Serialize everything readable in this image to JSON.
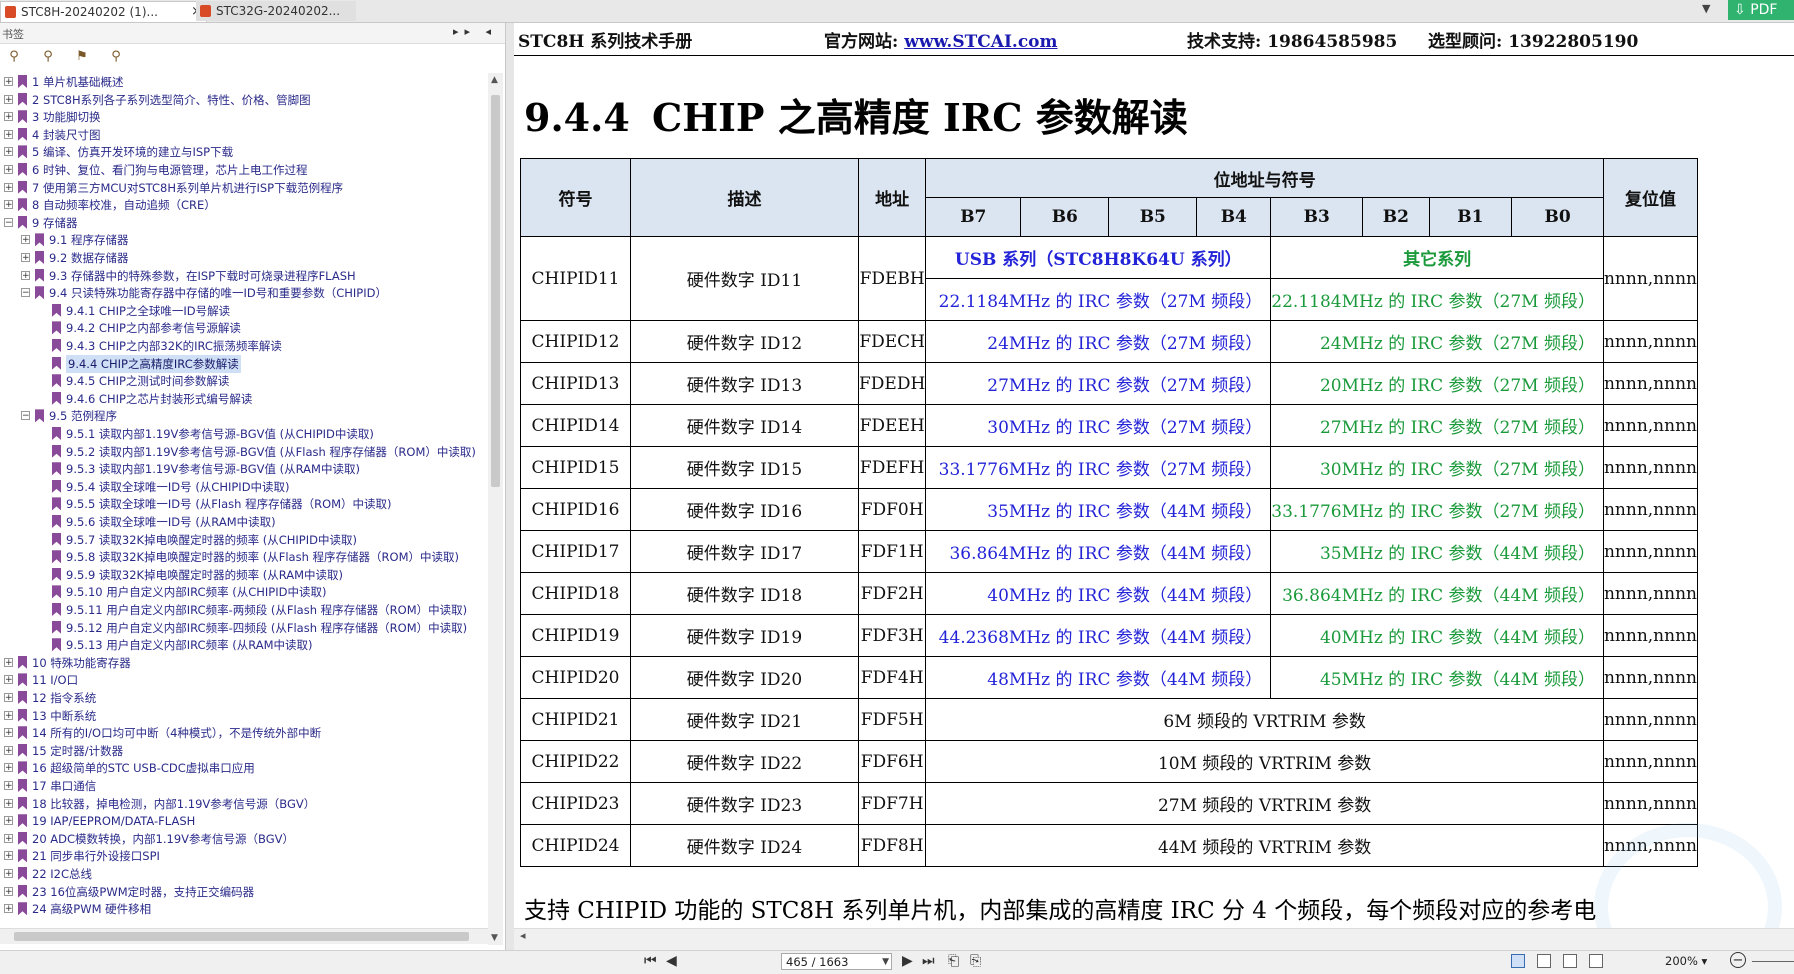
{
  "tabs": [
    {
      "label": "STC8H-20240202 (1)...",
      "close": "×",
      "active": true
    },
    {
      "label": "STC32G-20240202...",
      "active": false
    }
  ],
  "pdf_badge": "PDF",
  "bookmarks_panel": {
    "title": "书签",
    "header_controls": "▸▸ ◂",
    "items": [
      {
        "label": "1 单片机基础概述",
        "level": 0
      },
      {
        "label": "2  STC8H系列各子系列选型简介、特性、价格、管脚图",
        "level": 0
      },
      {
        "label": "3  功能脚切换",
        "level": 0
      },
      {
        "label": "4  封装尺寸图",
        "level": 0
      },
      {
        "label": "5  编译、仿真开发环境的建立与ISP下载",
        "level": 0
      },
      {
        "label": "6  时钟、复位、看门狗与电源管理，芯片上电工作过程",
        "level": 0
      },
      {
        "label": "7  使用第三方MCU对STC8H系列单片机进行ISP下载范例程序",
        "level": 0
      },
      {
        "label": "8  自动频率校准，自动追频（CRE）",
        "level": 0
      },
      {
        "label": "9  存储器",
        "level": 0,
        "expanded": true
      },
      {
        "label": "9.1 程序存储器",
        "level": 1
      },
      {
        "label": "9.2  数据存储器",
        "level": 1
      },
      {
        "label": "9.3  存储器中的特殊参数，在ISP下载时可烧录进程序FLASH",
        "level": 1
      },
      {
        "label": "9.4  只读特殊功能寄存器中存储的唯一ID号和重要参数（CHIPID）",
        "level": 1,
        "expanded": true
      },
      {
        "label": "9.4.1  CHIP之全球唯一ID号解读",
        "level": 2
      },
      {
        "label": "9.4.2 CHIP之内部参考信号源解读",
        "level": 2
      },
      {
        "label": "9.4.3 CHIP之内部32K的IRC振荡频率解读",
        "level": 2
      },
      {
        "label": "9.4.4  CHIP之高精度IRC参数解读",
        "level": 2,
        "selected": true
      },
      {
        "label": "9.4.5  CHIP之测试时间参数解读",
        "level": 2
      },
      {
        "label": "9.4.6 CHIP之芯片封装形式编号解读",
        "level": 2
      },
      {
        "label": "9.5  范例程序",
        "level": 1,
        "expanded": true
      },
      {
        "label": "9.5.1 读取内部1.19V参考信号源-BGV值 (从CHIPID中读取)",
        "level": 2
      },
      {
        "label": "9.5.2 读取内部1.19V参考信号源-BGV值 (从Flash 程序存储器（ROM）中读取)",
        "level": 2
      },
      {
        "label": "9.5.3 读取内部1.19V参考信号源-BGV值 (从RAM中读取)",
        "level": 2
      },
      {
        "label": "9.5.4 读取全球唯一ID号 (从CHIPID中读取)",
        "level": 2
      },
      {
        "label": "9.5.5 读取全球唯一ID号 (从Flash 程序存储器（ROM）中读取)",
        "level": 2
      },
      {
        "label": "9.5.6 读取全球唯一ID号 (从RAM中读取)",
        "level": 2
      },
      {
        "label": "9.5.7 读取32K掉电唤醒定时器的频率 (从CHIPID中读取)",
        "level": 2
      },
      {
        "label": "9.5.8 读取32K掉电唤醒定时器的频率 (从Flash 程序存储器（ROM）中读取)",
        "level": 2
      },
      {
        "label": "9.5.9 读取32K掉电唤醒定时器的频率 (从RAM中读取)",
        "level": 2
      },
      {
        "label": "9.5.10 用户自定义内部IRC频率 (从CHIPID中读取)",
        "level": 2
      },
      {
        "label": "9.5.11 用户自定义内部IRC频率-两频段 (从Flash 程序存储器（ROM）中读取)",
        "level": 2
      },
      {
        "label": "9.5.12 用户自定义内部IRC频率-四频段 (从Flash 程序存储器（ROM）中读取)",
        "level": 2
      },
      {
        "label": "9.5.13 用户自定义内部IRC频率 (从RAM中读取)",
        "level": 2
      },
      {
        "label": "10  特殊功能寄存器",
        "level": 0
      },
      {
        "label": "11  I/O口",
        "level": 0
      },
      {
        "label": "12  指令系统",
        "level": 0
      },
      {
        "label": "13  中断系统",
        "level": 0
      },
      {
        "label": "14  所有的I/O口均可中断（4种模式），不是传统外部中断",
        "level": 0
      },
      {
        "label": "15  定时器/计数器",
        "level": 0
      },
      {
        "label": "16  超级简单的STC USB-CDC虚拟串口应用",
        "level": 0
      },
      {
        "label": "17  串口通信",
        "level": 0
      },
      {
        "label": "18  比较器，掉电检测，内部1.19V参考信号源（BGV）",
        "level": 0
      },
      {
        "label": "19  IAP/EEPROM/DATA-FLASH",
        "level": 0
      },
      {
        "label": "20  ADC模数转换，内部1.19V参考信号源（BGV）",
        "level": 0
      },
      {
        "label": "21  同步串行外设接口SPI",
        "level": 0
      },
      {
        "label": "22  I2C总线",
        "level": 0
      },
      {
        "label": "23  16位高级PWM定时器，支持正交编码器",
        "level": 0
      },
      {
        "label": "24  高级PWM 硬件移相",
        "level": 0
      }
    ]
  },
  "document": {
    "header": {
      "manual": "STC8H 系列技术手册",
      "website_label": "官方网站: ",
      "website": "www.STCAI.com",
      "support": "技术支持: 19864585985",
      "advisor": "选型顾问: 13922805190"
    },
    "section_number": "9.4.4",
    "section_title": "CHIP 之高精度 IRC 参数解读",
    "table": {
      "headers": {
        "symbol": "符号",
        "desc": "描述",
        "addr": "地址",
        "bits_group": "位地址与符号",
        "reset": "复位值",
        "bits": [
          "B7",
          "B6",
          "B5",
          "B4",
          "B3",
          "B2",
          "B1",
          "B0"
        ]
      },
      "usb_series": "USB 系列（STC8H8K64U 系列）",
      "other_series": "其它系列",
      "rows": [
        {
          "symbol": "CHIPID11",
          "desc": "硬件数字 ID11",
          "addr": "FDEBH",
          "usb": "22.1184MHz 的 IRC 参数（27M 频段）",
          "other": "22.1184MHz 的 IRC 参数（27M 频段）",
          "reset": "nnnn,nnnn"
        },
        {
          "symbol": "CHIPID12",
          "desc": "硬件数字 ID12",
          "addr": "FDECH",
          "usb": "24MHz 的 IRC 参数（27M 频段）",
          "other": "24MHz 的 IRC 参数（27M 频段）",
          "reset": "nnnn,nnnn"
        },
        {
          "symbol": "CHIPID13",
          "desc": "硬件数字 ID13",
          "addr": "FDEDH",
          "usb": "27MHz 的 IRC 参数（27M 频段）",
          "other": "20MHz 的 IRC 参数（27M 频段）",
          "reset": "nnnn,nnnn"
        },
        {
          "symbol": "CHIPID14",
          "desc": "硬件数字 ID14",
          "addr": "FDEEH",
          "usb": "30MHz 的 IRC 参数（27M 频段）",
          "other": "27MHz 的 IRC 参数（27M 频段）",
          "reset": "nnnn,nnnn"
        },
        {
          "symbol": "CHIPID15",
          "desc": "硬件数字 ID15",
          "addr": "FDEFH",
          "usb": "33.1776MHz 的 IRC 参数（27M 频段）",
          "other": "30MHz 的 IRC 参数（27M 频段）",
          "reset": "nnnn,nnnn"
        },
        {
          "symbol": "CHIPID16",
          "desc": "硬件数字 ID16",
          "addr": "FDF0H",
          "usb": "35MHz 的 IRC 参数（44M 频段）",
          "other": "33.1776MHz 的 IRC 参数（27M 频段）",
          "reset": "nnnn,nnnn"
        },
        {
          "symbol": "CHIPID17",
          "desc": "硬件数字 ID17",
          "addr": "FDF1H",
          "usb": "36.864MHz 的 IRC 参数（44M 频段）",
          "other": "35MHz 的 IRC 参数（44M 频段）",
          "reset": "nnnn,nnnn"
        },
        {
          "symbol": "CHIPID18",
          "desc": "硬件数字 ID18",
          "addr": "FDF2H",
          "usb": "40MHz 的 IRC 参数（44M 频段）",
          "other": "36.864MHz 的 IRC 参数（44M 频段）",
          "reset": "nnnn,nnnn"
        },
        {
          "symbol": "CHIPID19",
          "desc": "硬件数字 ID19",
          "addr": "FDF3H",
          "usb": "44.2368MHz 的 IRC 参数（44M 频段）",
          "other": "40MHz 的 IRC 参数（44M 频段）",
          "reset": "nnnn,nnnn"
        },
        {
          "symbol": "CHIPID20",
          "desc": "硬件数字 ID20",
          "addr": "FDF4H",
          "usb": "48MHz 的 IRC 参数（44M 频段）",
          "other": "45MHz 的 IRC 参数（44M 频段）",
          "reset": "nnnn,nnnn"
        }
      ],
      "vrtrim_rows": [
        {
          "symbol": "CHIPID21",
          "desc": "硬件数字 ID21",
          "addr": "FDF5H",
          "param": "6M 频段的 VRTRIM 参数",
          "reset": "nnnn,nnnn"
        },
        {
          "symbol": "CHIPID22",
          "desc": "硬件数字 ID22",
          "addr": "FDF6H",
          "param": "10M 频段的 VRTRIM 参数",
          "reset": "nnnn,nnnn"
        },
        {
          "symbol": "CHIPID23",
          "desc": "硬件数字 ID23",
          "addr": "FDF7H",
          "param": "27M 频段的 VRTRIM 参数",
          "reset": "nnnn,nnnn"
        },
        {
          "symbol": "CHIPID24",
          "desc": "硬件数字 ID24",
          "addr": "FDF8H",
          "param": "44M 频段的 VRTRIM 参数",
          "reset": "nnnn,nnnn"
        }
      ]
    },
    "paragraph": "支持 CHIPID 功能的 STC8H 系列单片机，内部集成的高精度 IRC 分 4 个频段，每个频段对应的参考电"
  },
  "statusbar": {
    "page_field": "465 / 1663",
    "zoom": "200%"
  },
  "colors": {
    "usb_blue": "#2323d8",
    "other_green": "#1a9a3a",
    "header_bg": "#dbe5f1",
    "pdf_badge": "#2fb36f",
    "bookmark_text": "#2a2a8a"
  }
}
